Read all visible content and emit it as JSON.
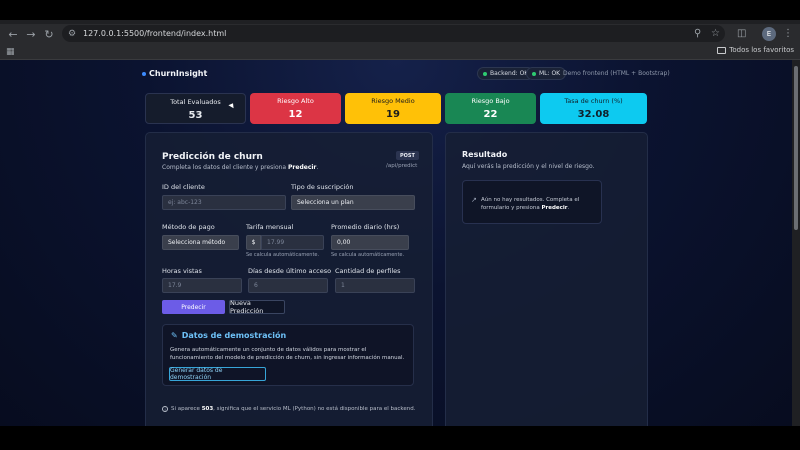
{
  "browser": {
    "url": "127.0.0.1:5500/frontend/index.html",
    "profile_initial": "E",
    "bookmarks_label": "Todos los favoritos"
  },
  "header": {
    "brand": "ChurnInsight",
    "backend_status": "Backend: OK",
    "ml_status": "ML: OK",
    "demo_note": "Demo frontend (HTML + Bootstrap)"
  },
  "stats": [
    {
      "label": "Total Evaluados",
      "value": "53",
      "bg": "#151c2c",
      "fg": "#e8ebf0"
    },
    {
      "label": "Riesgo Alto",
      "value": "12",
      "bg": "#dc3545",
      "fg": "#ffffff"
    },
    {
      "label": "Riesgo Medio",
      "value": "19",
      "bg": "#ffc107",
      "fg": "#1c1c1c"
    },
    {
      "label": "Riesgo Bajo",
      "value": "22",
      "bg": "#198754",
      "fg": "#ffffff"
    },
    {
      "label": "Tasa de churn (%)",
      "value": "32.08",
      "bg": "#0dcaf0",
      "fg": "#10202a"
    }
  ],
  "form": {
    "title": "Predicción de churn",
    "subtitle_prefix": "Completa los datos del cliente y presiona ",
    "subtitle_bold": "Predecir",
    "subtitle_suffix": ".",
    "method_badge": "POST",
    "endpoint": "/api/predict",
    "client_id_label": "ID del cliente",
    "client_id_placeholder": "ej: abc-123",
    "subscription_label": "Tipo de suscripción",
    "subscription_value": "Selecciona un plan",
    "payment_label": "Método de pago",
    "payment_value": "Selecciona método",
    "monthly_fee_label": "Tarifa mensual",
    "currency_prefix": "$",
    "monthly_fee_value": "17.99",
    "monthly_fee_hint": "Se calcula automáticamente.",
    "daily_avg_label": "Promedio diario (hrs)",
    "daily_avg_value": "0,00",
    "daily_avg_hint": "Se calcula automáticamente.",
    "hours_label": "Horas vistas",
    "hours_value": "17.9",
    "days_label": "Días desde último acceso",
    "days_value": "6",
    "profiles_label": "Cantidad de perfiles",
    "profiles_value": "1",
    "predict_button": "Predecir",
    "new_button": "Nueva Predicción"
  },
  "demo": {
    "title": "Datos de demostración",
    "description": "Genera automáticamente un conjunto de datos válidos para mostrar el funcionamiento del modelo de predicción de churn, sin ingresar información manual.",
    "button": "Generar datos de demostración"
  },
  "footnote": {
    "prefix": "Si aparece ",
    "code": "503",
    "suffix": ", significa que el servicio ML (Python) no está disponible para el backend."
  },
  "result": {
    "title": "Resultado",
    "subtitle": "Aquí verás la predicción y el nivel de riesgo.",
    "empty_prefix": "Aún no hay resultados. Completa el formulario y presiona ",
    "empty_bold": "Predecir",
    "empty_suffix": "."
  }
}
